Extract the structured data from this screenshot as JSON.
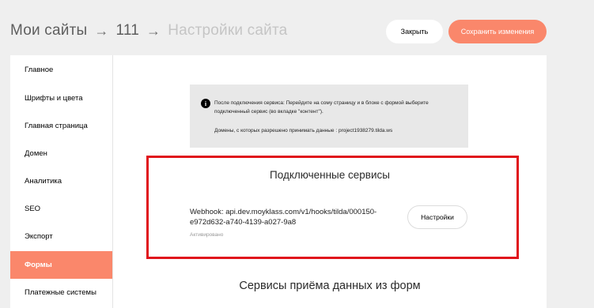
{
  "header": {
    "breadcrumb": [
      "Мои сайты",
      "111",
      "Настройки сайта"
    ],
    "arrow": "→",
    "close_label": "Закрыть",
    "save_label": "Сохранить изменения"
  },
  "sidebar": {
    "items": [
      {
        "label": "Главное"
      },
      {
        "label": "Шрифты и цвета"
      },
      {
        "label": "Главная страница"
      },
      {
        "label": "Домен"
      },
      {
        "label": "Аналитика"
      },
      {
        "label": "SEO"
      },
      {
        "label": "Экспорт"
      },
      {
        "label": "Формы",
        "active": true
      },
      {
        "label": "Платежные системы"
      }
    ]
  },
  "notice": {
    "icon": "info-icon",
    "text": "После подключения сервиса: Перейдите на сому страницу и в блоке с формой выберите подключенный сервис (во вкладке \"контент\").",
    "domains": "Домены, с которых разрешено принимать данные : project1938279.tilda.ws"
  },
  "connected": {
    "title": "Подключенные сервисы",
    "webhook": "Webhook: api.dev.moyklass.com/v1/hooks/tilda/000150-e972d632-a740-4139-a027-9a8",
    "status": "Активировано",
    "settings_label": "Настройки"
  },
  "forms_section": {
    "title": "Сервисы приёма данных из форм"
  },
  "colors": {
    "accent": "#fa876b",
    "highlight": "#e0141c",
    "page_bg": "#efefef"
  }
}
